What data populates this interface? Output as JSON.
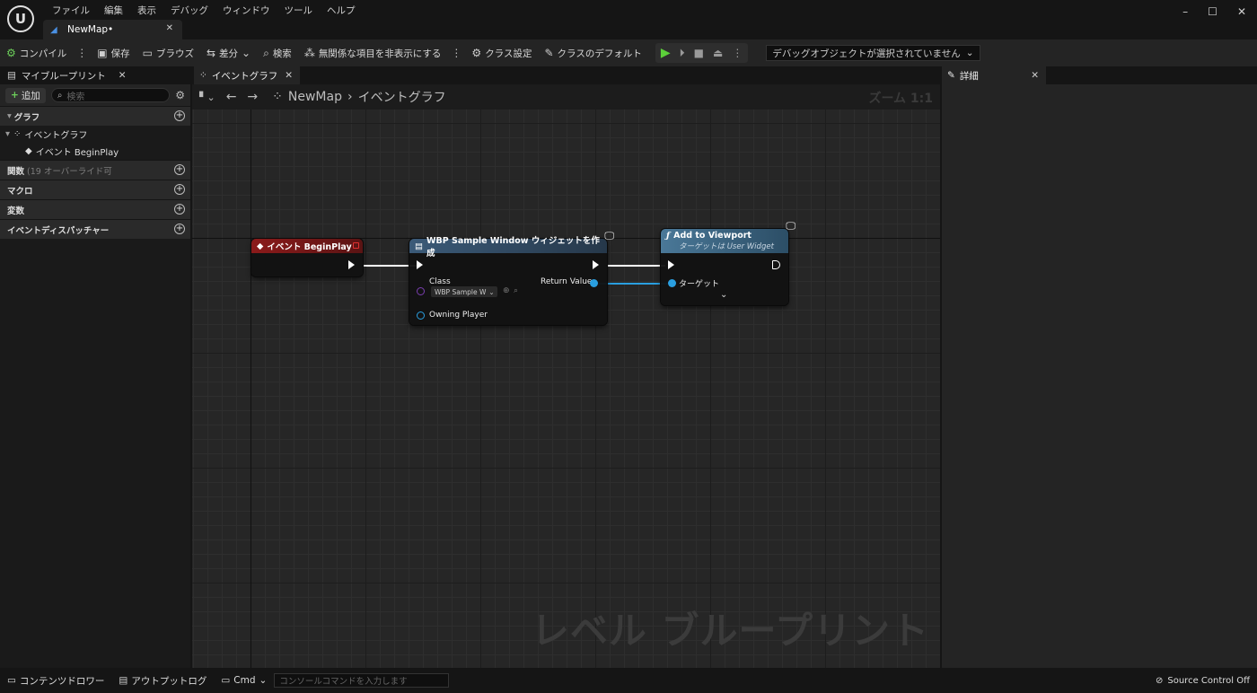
{
  "titlebar": {
    "menu": [
      "ファイル",
      "編集",
      "表示",
      "デバッグ",
      "ウィンドウ",
      "ツール",
      "ヘルプ"
    ],
    "document_tab": "NewMap•",
    "window_controls": [
      "–",
      "☐",
      "✕"
    ]
  },
  "toolbar": {
    "compile": "コンパイル",
    "save": "保存",
    "browse": "ブラウズ",
    "diff": "差分",
    "search": "検索",
    "hide_unrelated": "無関係な項目を非表示にする",
    "class_settings": "クラス設定",
    "class_defaults": "クラスのデフォルト",
    "debug_object": "デバッグオブジェクトが選択されていません"
  },
  "my_blueprint": {
    "tab_label": "マイブループリント",
    "add_label": "追加",
    "search_placeholder": "検索",
    "sections": {
      "graphs": "グラフ",
      "functions": "関数",
      "functions_note": "(19 オーバーライド可",
      "macros": "マクロ",
      "variables": "変数",
      "dispatchers": "イベントディスパッチャー"
    },
    "tree": {
      "event_graph": "イベントグラフ",
      "begin_play": "イベント BeginPlay"
    }
  },
  "graph": {
    "tab_label": "イベントグラフ",
    "breadcrumb_root": "NewMap",
    "breadcrumb_current": "イベントグラフ",
    "zoom": "ズーム 1:1",
    "watermark": "レベル ブループリント",
    "nodes": {
      "begin_play": {
        "title": "イベント BeginPlay",
        "color": "#8b1a1a"
      },
      "create_widget": {
        "title": "WBP Sample Window ウィジェットを作成",
        "color": "#3b5a78",
        "class_label": "Class",
        "class_value": "WBP Sample W",
        "return_label": "Return Value",
        "owning_label": "Owning Player"
      },
      "add_to_viewport": {
        "title": "Add to Viewport",
        "subtitle": "ターゲットは User Widget",
        "color": "#4a7898",
        "target_label": "ターゲット"
      }
    }
  },
  "details": {
    "tab_label": "詳細"
  },
  "statusbar": {
    "content_drawer": "コンテンツドロワー",
    "output_log": "アウトプットログ",
    "cmd": "Cmd",
    "cmd_placeholder": "コンソールコマンドを入力します",
    "source_control": "Source Control Off"
  }
}
